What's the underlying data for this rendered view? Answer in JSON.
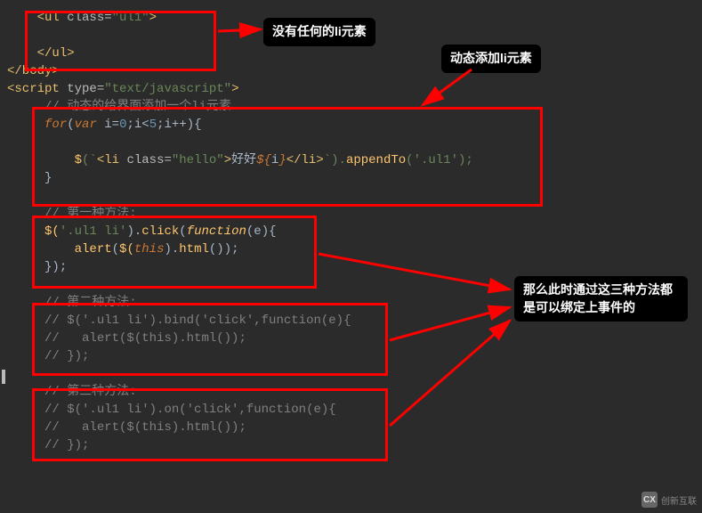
{
  "bubbles": {
    "b1": "没有任何的li元素",
    "b2": "动态添加li元素",
    "b3": "那么此时通过这三种方法都是可以绑定上事件的"
  },
  "code": {
    "l1_open": "<ul",
    "l1_class": " class=",
    "l1_val": "\"ul1\"",
    "l1_close": ">",
    "l2_ul_close": "</ul>",
    "l3_body_close": "</body>",
    "l4_script_open": "<script",
    "l4_type": " type=",
    "l4_type_val": "\"text/javascript\"",
    "l4_close": ">",
    "c_dynamic": "// 动态的给界面添加一个li元素",
    "kw_for": "for",
    "kw_var": "var",
    "for_init": " i=",
    "for_zero": "0",
    "for_cond": ";i<",
    "for_five": "5",
    "for_inc": ";i++){",
    "jq": "$",
    "tpl_open": "(`",
    "li_open": "<li",
    "li_class": " class=",
    "li_class_val": "\"hello\"",
    "li_close1": ">",
    "li_text": "好好",
    "tpl_expr_open": "${",
    "tpl_i": "i",
    "tpl_expr_close": "}",
    "li_end": "</li>",
    "tpl_close": "`).",
    "appendTo": "appendTo",
    "appendTo_arg": "('.ul1');",
    "brace_close": "}",
    "c_method1": "// 第一种方法:",
    "m1_sel_open": "$(",
    "m1_sel": "'.ul1 li'",
    "m1_sel_close": ").",
    "click": "click",
    "fn_open": "(",
    "kw_function": "function",
    "fn_param": "(e){",
    "alert": "alert",
    "alert_open": "(",
    "jq_this_open": "$(",
    "kw_this": "this",
    "jq_this_close": ").",
    "html_m": "html",
    "html_call": "());",
    "fn_end": "});",
    "c_method2_a": "// 第二种方法:",
    "c_method2_b": "// $('.ul1 li').bind('click',function(e){",
    "c_method2_c": "//   alert($(this).html());",
    "c_method2_d": "// });",
    "c_method3_a": "// 第三种方法:",
    "c_method3_b": "// $('.ul1 li').on('click',function(e){",
    "c_method3_c": "//   alert($(this).html());",
    "c_method3_d": "// });"
  },
  "watermark": {
    "logo": "CX",
    "text": "创新互联"
  }
}
